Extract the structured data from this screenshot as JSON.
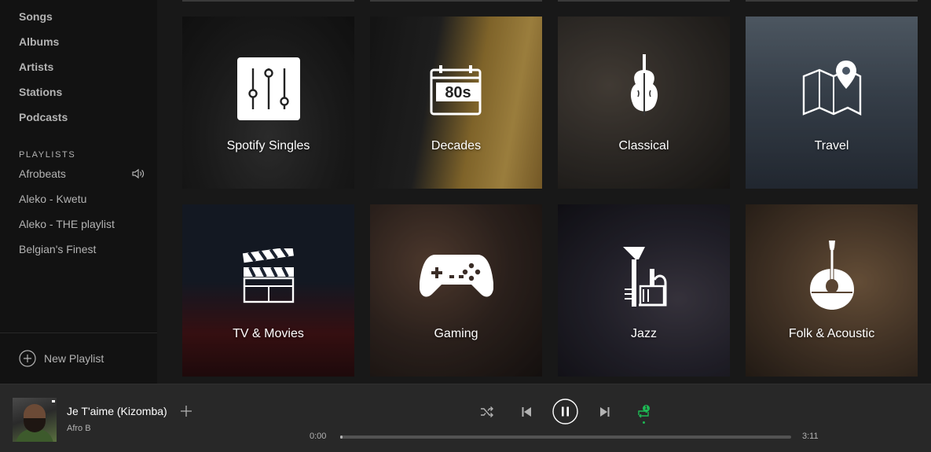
{
  "sidebar": {
    "library": [
      "Songs",
      "Albums",
      "Artists",
      "Stations",
      "Podcasts"
    ],
    "playlists_label": "PLAYLISTS",
    "playlists": [
      "Afrobeats",
      "Aleko - Kwetu",
      "Aleko - THE playlist",
      "Belgian's Finest"
    ],
    "new_playlist": "New Playlist"
  },
  "genres": [
    {
      "label": "Spotify Singles",
      "icon": "sliders-icon",
      "color": "#2a2a2a"
    },
    {
      "label": "Decades",
      "icon": "calendar-80s-icon",
      "color": "#8a6a2a"
    },
    {
      "label": "Classical",
      "icon": "violin-icon",
      "color": "#3b3631"
    },
    {
      "label": "Travel",
      "icon": "map-pin-icon",
      "color": "#4a5664"
    },
    {
      "label": "TV & Movies",
      "icon": "clapperboard-icon",
      "color": "#1b2230"
    },
    {
      "label": "Gaming",
      "icon": "gamepad-icon",
      "color": "#3a2c26"
    },
    {
      "label": "Jazz",
      "icon": "trumpet-icon",
      "color": "#252532"
    },
    {
      "label": "Folk & Acoustic",
      "icon": "mandolin-icon",
      "color": "#5a4533"
    }
  ],
  "player": {
    "title": "Je T'aime (Kizomba)",
    "artist": "Afro B",
    "elapsed": "0:00",
    "duration": "3:11",
    "progress": 0.004,
    "repeat_badge": "1",
    "accent": "#1db954"
  }
}
